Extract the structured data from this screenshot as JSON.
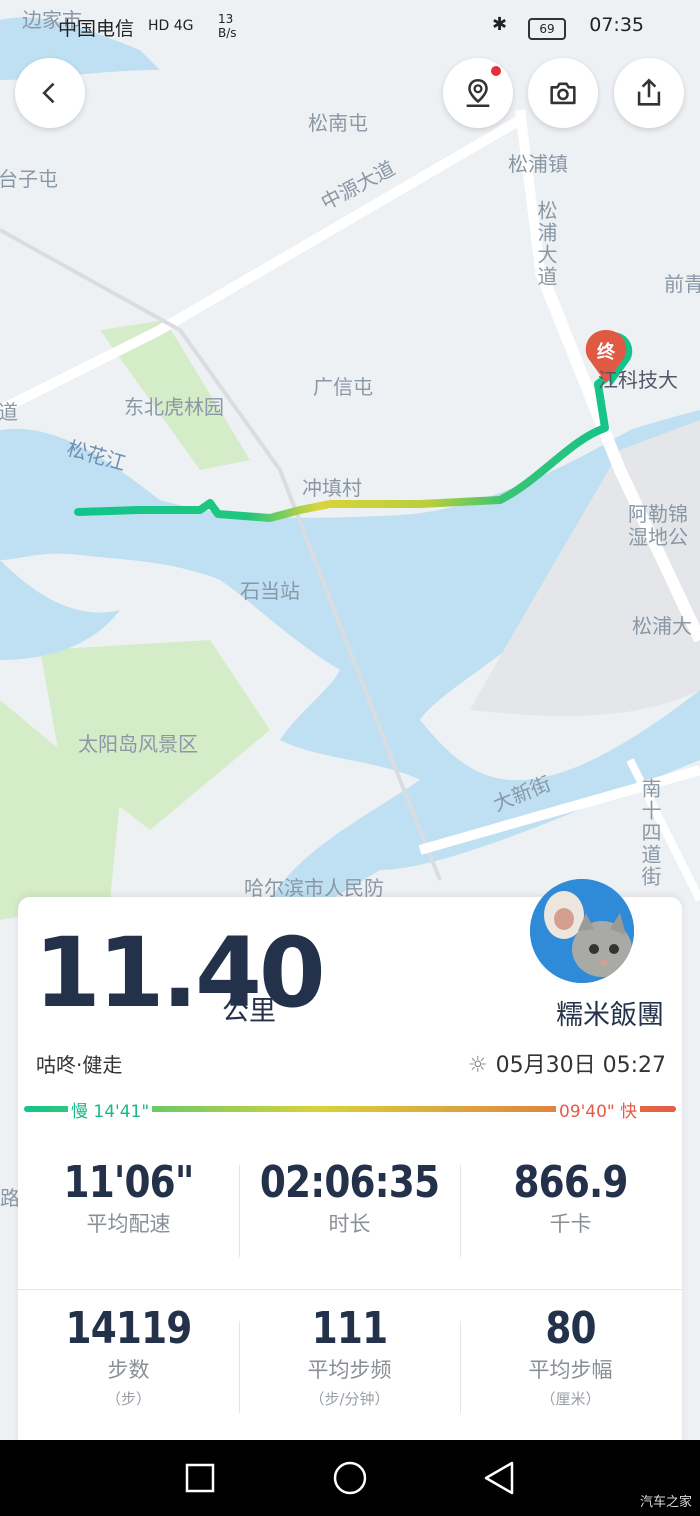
{
  "status_bar": {
    "carrier": "中国电信",
    "network": "HD 4G",
    "speed": "13 B/s",
    "battery": "69",
    "time": "07:35"
  },
  "map": {
    "labels": [
      {
        "text": "边家市"
      },
      {
        "text": "台子屯"
      },
      {
        "text": "松南屯"
      },
      {
        "text": "松浦镇"
      },
      {
        "text": "中源大道"
      },
      {
        "text": "松浦大道"
      },
      {
        "text": "前青"
      },
      {
        "text": "广信屯"
      },
      {
        "text": "东北虎林园"
      },
      {
        "text": "道"
      },
      {
        "text": "松花江"
      },
      {
        "text": "冲填村"
      },
      {
        "text": "江科技大"
      },
      {
        "text": "阿勒锦"
      },
      {
        "text": "湿地公"
      },
      {
        "text": "石当站"
      },
      {
        "text": "松浦大"
      },
      {
        "text": "太阳岛风景区"
      },
      {
        "text": "大新街"
      },
      {
        "text": "南十四道街"
      },
      {
        "text": "哈尔滨市人民防"
      },
      {
        "text": "路"
      }
    ],
    "end_marker": "终"
  },
  "summary": {
    "distance": "11.40",
    "unit": "公里",
    "username": "糯米飯團",
    "activity": "咕咚·健走",
    "datetime": "05月30日 05:27",
    "pace_slow": "慢 14'41\"",
    "pace_fast": "09'40\" 快",
    "stats_row1": [
      {
        "value": "11'06\"",
        "label": "平均配速"
      },
      {
        "value": "02:06:35",
        "label": "时长"
      },
      {
        "value": "866.9",
        "label": "千卡"
      }
    ],
    "stats_row2": [
      {
        "value": "14119",
        "label": "步数",
        "sub": "（步）"
      },
      {
        "value": "111",
        "label": "平均步频",
        "sub": "（步/分钟）"
      },
      {
        "value": "80",
        "label": "平均步幅",
        "sub": "（厘米）"
      }
    ]
  },
  "watermark": "汽车之家",
  "colors": {
    "route_start": "#12c48b",
    "route_mid": "#d8d23a",
    "pace_fast": "#e35d46",
    "marker": "#e05a43"
  }
}
